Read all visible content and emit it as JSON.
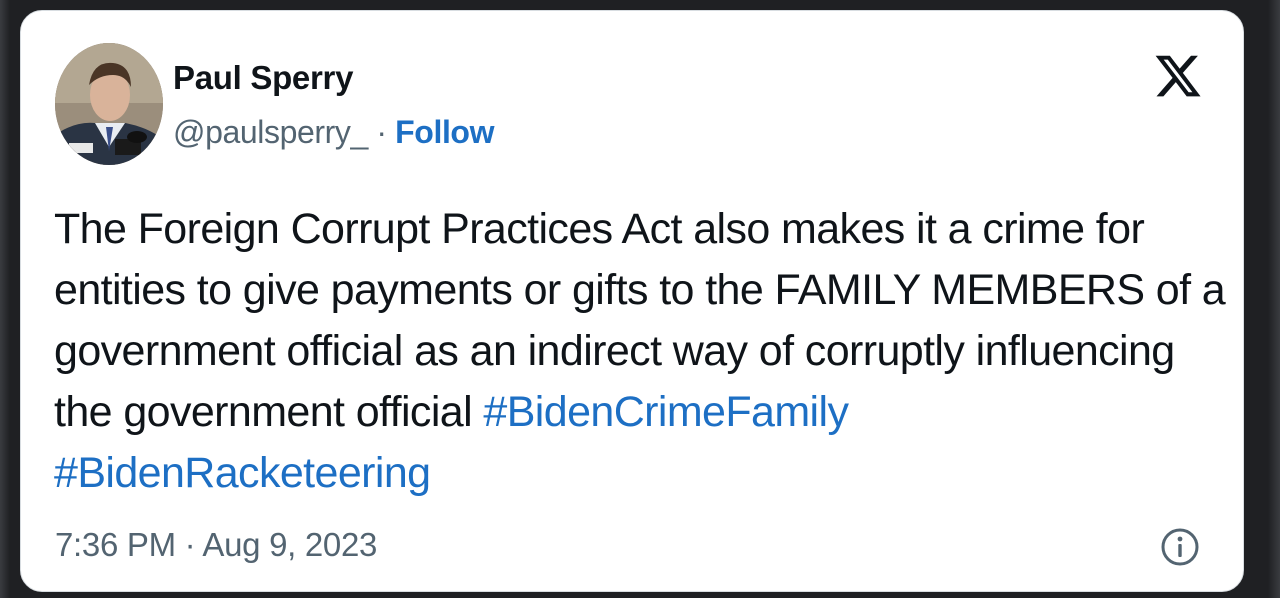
{
  "tweet": {
    "author_name": "Paul Sperry",
    "author_handle": "@paulsperry_",
    "separator": "·",
    "follow_label": "Follow",
    "text_part1": "The Foreign Corrupt Practices Act also makes it a crime for entities to give payments or gifts to the FAMILY MEMBERS of a government official as an indirect way of corruptly influencing the government official ",
    "hashtag1": "#BidenCrimeFamily",
    "hashtag2": "#BidenRacketeering",
    "timestamp": "7:36 PM · Aug 9, 2023"
  },
  "icons": {
    "brand": "x-logo-icon",
    "info": "info-icon"
  },
  "colors": {
    "link": "#1d6fc4",
    "text": "#0f1419",
    "muted": "#536471"
  }
}
